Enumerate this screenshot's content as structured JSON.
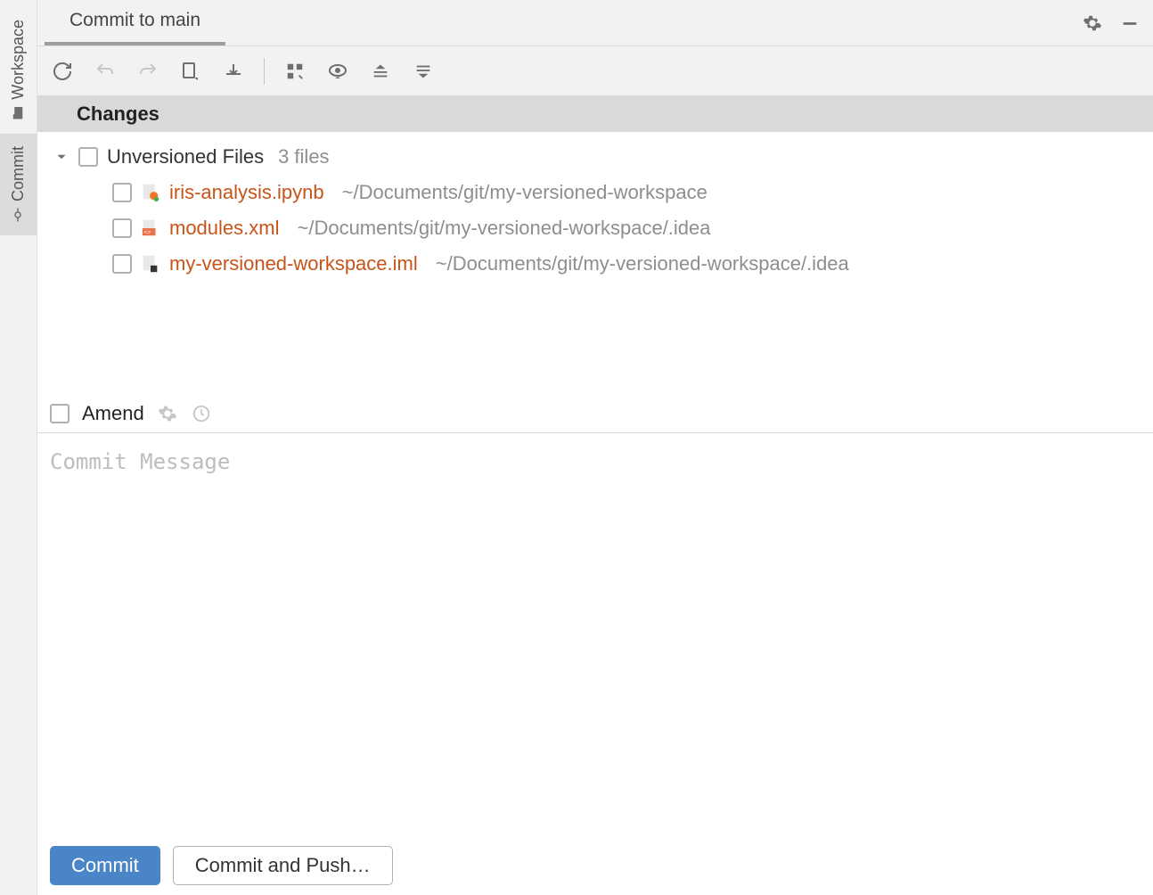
{
  "sidebar": {
    "tabs": [
      {
        "label": "Workspace",
        "icon": "folder-icon",
        "active": false
      },
      {
        "label": "Commit",
        "icon": "commit-icon",
        "active": true
      }
    ]
  },
  "header": {
    "tab_label": "Commit to main"
  },
  "changes": {
    "title": "Changes",
    "group_label": "Unversioned Files",
    "group_count": "3 files",
    "files": [
      {
        "name": "iris-analysis.ipynb",
        "path": "~/Documents/git/my-versioned-workspace",
        "icon": "jupyter"
      },
      {
        "name": "modules.xml",
        "path": "~/Documents/git/my-versioned-workspace/.idea",
        "icon": "xml"
      },
      {
        "name": "my-versioned-workspace.iml",
        "path": "~/Documents/git/my-versioned-workspace/.idea",
        "icon": "iml"
      }
    ]
  },
  "amend": {
    "label": "Amend"
  },
  "commit_message": {
    "placeholder": "Commit Message"
  },
  "buttons": {
    "commit": "Commit",
    "commit_and_push": "Commit and Push…"
  }
}
